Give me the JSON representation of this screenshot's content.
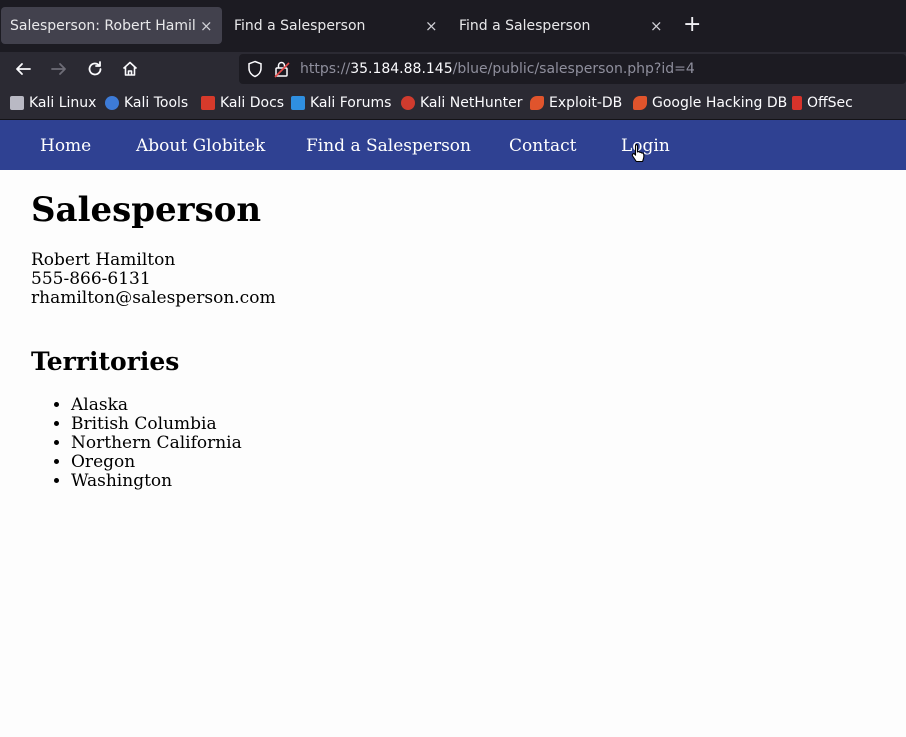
{
  "browser": {
    "tabs": [
      {
        "title": "Salesperson: Robert Hamilto",
        "close": "×"
      },
      {
        "title": "Find a Salesperson",
        "close": "×"
      },
      {
        "title": "Find a Salesperson",
        "close": "×"
      }
    ],
    "new_tab": "+",
    "url": {
      "scheme": "https://",
      "host": "35.184.88.145",
      "path": "/blue/public/salesperson.php?id=4"
    },
    "bookmarks": [
      {
        "label": "Kali Linux",
        "icon": "kali-dragon-icon",
        "color": "#b9b9c4"
      },
      {
        "label": "Kali Tools",
        "icon": "kali-tools-icon",
        "color": "#3d7bd8"
      },
      {
        "label": "Kali Docs",
        "icon": "kali-docs-icon",
        "color": "#d63a2b"
      },
      {
        "label": "Kali Forums",
        "icon": "kali-forums-icon",
        "color": "#2f8fe0"
      },
      {
        "label": "Kali NetHunter",
        "icon": "nethunter-icon",
        "color": "#d03b2e"
      },
      {
        "label": "Exploit-DB",
        "icon": "exploit-db-icon",
        "color": "#e0542c"
      },
      {
        "label": "Google Hacking DB",
        "icon": "ghdb-icon",
        "color": "#e0542c"
      },
      {
        "label": "OffSec",
        "icon": "offsec-icon",
        "color": "#d8332b"
      }
    ]
  },
  "site": {
    "nav": [
      "Home",
      "About Globitek",
      "Find a Salesperson",
      "Contact",
      "Login"
    ],
    "page_title": "Salesperson",
    "person": {
      "name": "Robert Hamilton",
      "phone": "555-866-6131",
      "email": "rhamilton@salesperson.com"
    },
    "territories_heading": "Territories",
    "territories": [
      "Alaska",
      "British Columbia",
      "Northern California",
      "Oregon",
      "Washington"
    ]
  },
  "colors": {
    "site_nav": "#2f4192",
    "tab_bar": "#1c1b22",
    "toolbar": "#2b2a33"
  }
}
